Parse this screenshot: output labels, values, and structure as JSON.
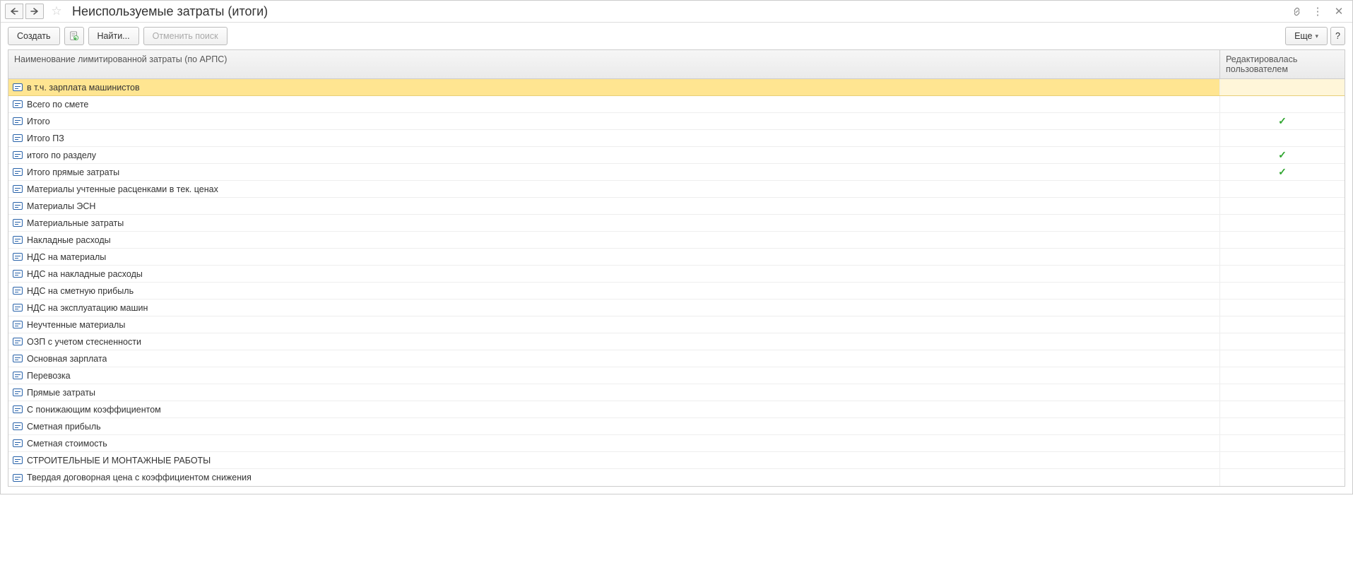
{
  "header": {
    "title": "Неиспользуемые затраты (итоги)"
  },
  "toolbar": {
    "create": "Создать",
    "find": "Найти...",
    "cancel_search": "Отменить поиск",
    "more": "Еще",
    "help": "?"
  },
  "table": {
    "columns": {
      "name": "Наименование лимитированной затраты (по АРПС)",
      "edited_by_user": "Редактировалась пользователем"
    },
    "rows": [
      {
        "name": "в т.ч. зарплата машинистов",
        "edited": false,
        "selected": true
      },
      {
        "name": "Всего по смете",
        "edited": false
      },
      {
        "name": "Итого",
        "edited": true
      },
      {
        "name": "Итого ПЗ",
        "edited": false
      },
      {
        "name": "итого по разделу",
        "edited": true
      },
      {
        "name": "Итого прямые затраты",
        "edited": true
      },
      {
        "name": "Материалы учтенные расценками в тек. ценах",
        "edited": false
      },
      {
        "name": "Материалы ЭСН",
        "edited": false
      },
      {
        "name": "Материальные затраты",
        "edited": false
      },
      {
        "name": "Накладные расходы",
        "edited": false
      },
      {
        "name": "НДС на материалы",
        "edited": false
      },
      {
        "name": "НДС на накладные расходы",
        "edited": false
      },
      {
        "name": "НДС на сметную прибыль",
        "edited": false
      },
      {
        "name": "НДС на эксплуатацию машин",
        "edited": false
      },
      {
        "name": "Неучтенные материалы",
        "edited": false
      },
      {
        "name": "ОЗП с учетом стесненности",
        "edited": false
      },
      {
        "name": "Основная зарплата",
        "edited": false
      },
      {
        "name": "Перевозка",
        "edited": false
      },
      {
        "name": "Прямые затраты",
        "edited": false
      },
      {
        "name": "С понижающим коэффициентом",
        "edited": false
      },
      {
        "name": "Сметная прибыль",
        "edited": false
      },
      {
        "name": "Сметная стоимость",
        "edited": false
      },
      {
        "name": "СТРОИТЕЛЬНЫЕ И МОНТАЖНЫЕ РАБОТЫ",
        "edited": false
      },
      {
        "name": "Твердая договорная цена с коэффициентом снижения",
        "edited": false
      }
    ]
  }
}
